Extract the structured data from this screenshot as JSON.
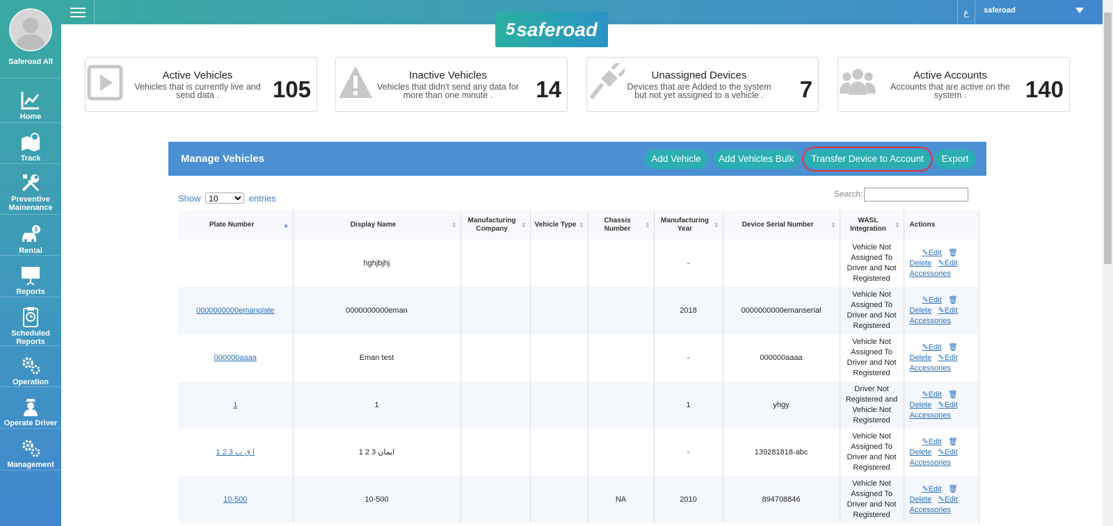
{
  "user": {
    "name": "Saferoad All",
    "account": "saferoad",
    "lang_toggle": "ع"
  },
  "brand": {
    "logo_text": "saferoad",
    "logo_mark": "5",
    "accent": "#2aaeb2",
    "header_blue": "#4a90d2",
    "highlight_red": "#e0393a"
  },
  "sidebar": {
    "items": [
      {
        "label": "Home",
        "icon": "chart-icon"
      },
      {
        "label": "Track",
        "icon": "map-icon"
      },
      {
        "label": "Preventive Mainenance",
        "icon": "wrench-screwdriver-icon"
      },
      {
        "label": "Rental",
        "icon": "car-dollar-icon"
      },
      {
        "label": "Reports",
        "icon": "presentation-icon"
      },
      {
        "label": "Scheduled Reports",
        "icon": "clipboard-clock-icon"
      },
      {
        "label": "Operation",
        "icon": "gears-icon"
      },
      {
        "label": "Operate Driver",
        "icon": "driver-icon"
      },
      {
        "label": "Management",
        "icon": "gears-icon"
      }
    ]
  },
  "stats": [
    {
      "title": "Active Vehicles",
      "desc": "Vehicles that is currently live and send data .",
      "value": "105",
      "icon": "play-icon"
    },
    {
      "title": "Inactive Vehicles",
      "desc": "Vehicles that didn't send any data for more than one minute .",
      "value": "14",
      "icon": "warning-icon"
    },
    {
      "title": "Unassigned Devices",
      "desc": "Devices that are Added to the system but not yet assigned to a vehicle .",
      "value": "7",
      "icon": "plug-icon"
    },
    {
      "title": "Active Accounts",
      "desc": "Accounts that are active on the system .",
      "value": "140",
      "icon": "users-icon"
    }
  ],
  "panel": {
    "title": "Manage Vehicles",
    "buttons": {
      "add_vehicle": "Add Vehicle",
      "add_bulk": "Add Vehicles Bulk",
      "transfer": "Transfer Device to Account",
      "export": "Export"
    },
    "show_label": "Show",
    "entries_label": "entries",
    "page_size": "10",
    "search_label": "Search:",
    "search_value": ""
  },
  "table": {
    "columns": {
      "plate": "Plate Number",
      "display": "Display Name",
      "company": "Manufacturing Company",
      "type": "Vehicle Type",
      "chassis": "Chassis Number",
      "year": "Manufacturing Year",
      "serial": "Device Serial Number",
      "wasl": "WASL Integration",
      "actions": "Actions"
    },
    "actions": {
      "edit": "Edit",
      "delete": "Delete",
      "edit_accessories": "Edit Accessories"
    },
    "rows": [
      {
        "plate": "",
        "display": "hghjbjhj",
        "company": "",
        "type": "",
        "chassis": "",
        "year": "-",
        "serial": "",
        "wasl": "Vehicle Not Assigned To Driver and Not Registered"
      },
      {
        "plate": "0000000000emanplate",
        "display": "0000000000eman",
        "company": "",
        "type": "",
        "chassis": "",
        "year": "2018",
        "serial": "0000000000emanserial",
        "wasl": "Vehicle Not Assigned To Driver and Not Registered"
      },
      {
        "plate": "000000aaaa",
        "display": "Eman test",
        "company": "",
        "type": "",
        "chassis": "",
        "year": "-",
        "serial": "000000aaaa",
        "wasl": "Vehicle Not Assigned To Driver and Not Registered"
      },
      {
        "plate": "1",
        "display": "1",
        "company": "",
        "type": "",
        "chassis": "",
        "year": "1",
        "serial": "yhgy",
        "wasl": "Driver Not Registered and Vehicle Not Registered"
      },
      {
        "plate": "1 2 3 ا ق ت",
        "display": "1 2 3 ايمان",
        "company": "",
        "type": "",
        "chassis": "",
        "year": "-",
        "serial": "139281818-abc",
        "wasl": "Vehicle Not Assigned To Driver and Not Registered"
      },
      {
        "plate": "10-500",
        "display": "10-500",
        "company": "",
        "type": "",
        "chassis": "NA",
        "year": "2010",
        "serial": "894708846",
        "wasl": "Vehicle Not Assigned To Driver and Not Registered"
      }
    ]
  }
}
